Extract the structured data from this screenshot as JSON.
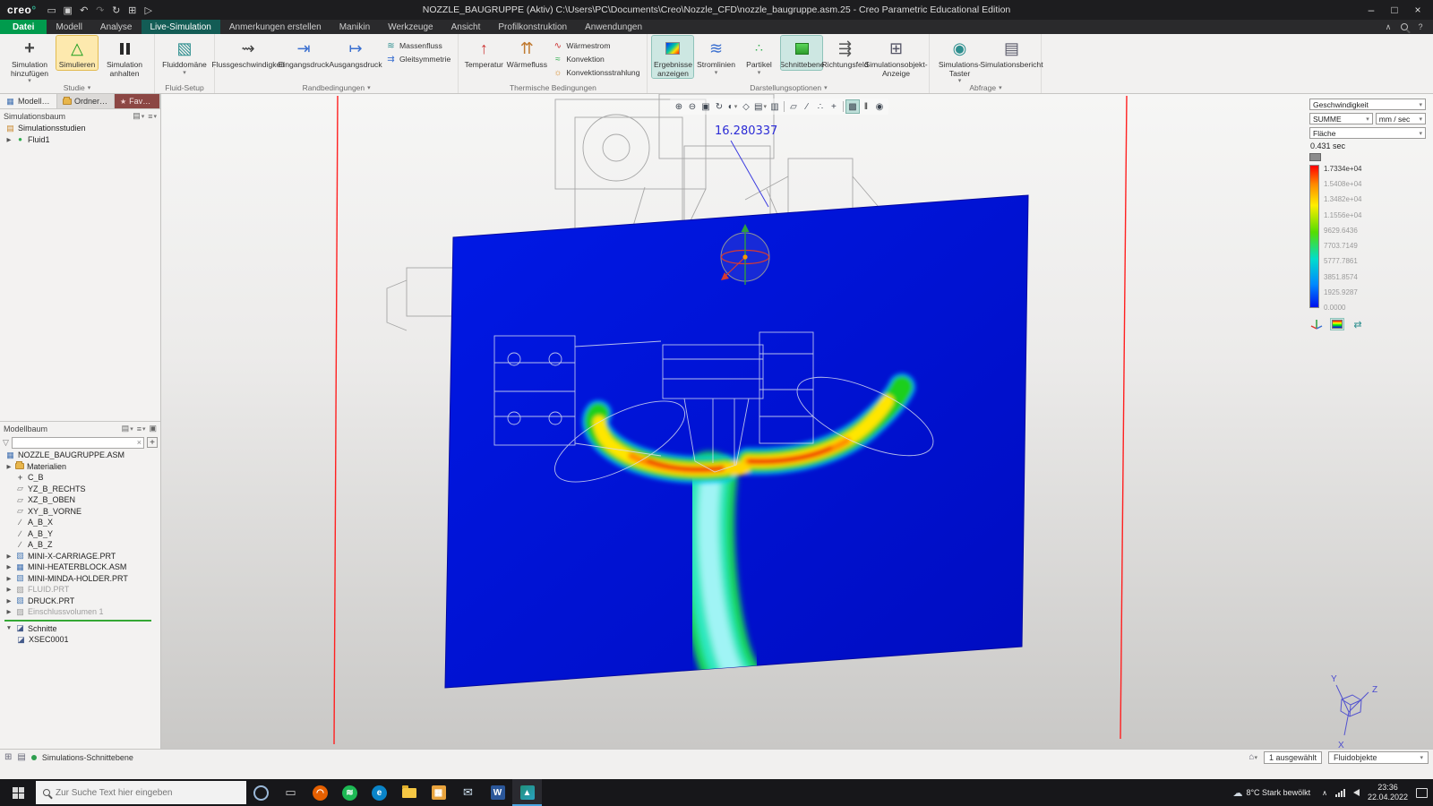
{
  "titlebar": {
    "logo": "creo",
    "title": "NOZZLE_BAUGRUPPE (Aktiv) C:\\Users\\PC\\Documents\\Creo\\Nozzle_CFD\\nozzle_baugruppe.asm.25 - Creo Parametric Educational Edition"
  },
  "ribbon": {
    "tabs": [
      "Datei",
      "Modell",
      "Analyse",
      "Live-Simulation",
      "Anmerkungen erstellen",
      "Manikin",
      "Werkzeuge",
      "Ansicht",
      "Profilkonstruktion",
      "Anwendungen"
    ],
    "studie": {
      "label": "Studie",
      "add": "Simulation hinzufügen",
      "run": "Simulieren",
      "stop": "Simulation anhalten"
    },
    "fluid": {
      "label": "Fluid-Setup",
      "domain": "Fluiddomäne"
    },
    "rand": {
      "label": "Randbedingungen",
      "flow": "Flussgeschwindigkeit",
      "inlet": "Eingangsdruck",
      "outlet": "Ausgangsdruck",
      "mass": "Massenfluss",
      "slip": "Gleitsymmetrie"
    },
    "therm": {
      "label": "Thermische Bedingungen",
      "temp": "Temperatur",
      "flux": "Wärmefluss",
      "stream": "Wärmestrom",
      "conv": "Konvektion",
      "rad": "Konvektionsstrahlung"
    },
    "darst": {
      "label": "Darstellungsoptionen",
      "results": "Ergebnisse anzeigen",
      "stream": "Stromlinien",
      "part": "Partikel",
      "cut": "Schnittebene",
      "vec": "Richtungsfeld",
      "simobj": "Simulationsobjekt-Anzeige"
    },
    "abfrage": {
      "label": "Abfrage",
      "probe": "Simulations-Taster",
      "report": "Simulationsbericht"
    }
  },
  "panel": {
    "tabs": [
      "Modellbaum",
      "Ordner-Browser",
      "Favoriten"
    ],
    "sim": {
      "header": "Simulationsbaum",
      "root": "Simulationsstudien",
      "study": "Fluid1"
    },
    "model": {
      "header": "Modellbaum",
      "items": [
        "NOZZLE_BAUGRUPPE.ASM",
        "Materialien",
        "C_B",
        "YZ_B_RECHTS",
        "XZ_B_OBEN",
        "XY_B_VORNE",
        "A_B_X",
        "A_B_Y",
        "A_B_Z",
        "MINI-X-CARRIAGE.PRT",
        "MINI-HEATERBLOCK.ASM",
        "MINI-MINDA-HOLDER.PRT",
        "FLUID.PRT",
        "DRUCK.PRT",
        "Einschlussvolumen 1",
        "Schnitte",
        "XSEC0001"
      ]
    }
  },
  "graphics": {
    "probe": "16.280337",
    "triad": {
      "x": "X",
      "y": "Y",
      "z": "Z"
    }
  },
  "legend": {
    "field": "Geschwindigkeit",
    "agg": "SUMME",
    "unit": "mm / sec",
    "display": "Fläche",
    "time": "0.431 sec",
    "values": [
      "1.7334e+04",
      "1.5408e+04",
      "1.3482e+04",
      "1.1556e+04",
      "9629.6436",
      "7703.7149",
      "5777.7861",
      "3851.8574",
      "1925.9287",
      "0.0000"
    ]
  },
  "statusbar": {
    "message": "Simulations-Schnittebene",
    "selected": "1 ausgewählt",
    "filter": "Fluidobjekte"
  },
  "taskbar": {
    "search_placeholder": "Zur Suche Text hier eingeben",
    "weather": "8°C Stark bewölkt",
    "time": "23:36",
    "date": "22.04.2022"
  },
  "colors": {
    "datei_green": "#009b4d",
    "accent_teal": "#cde7e2",
    "highlight_amber": "#fde9ae",
    "plane_blue": "#0a12d8",
    "boundary_red": "#ff2020",
    "taskbar_accent": "#4aa3e0",
    "legend_top": "#ff0000",
    "legend_bottom": "#0011ee"
  }
}
